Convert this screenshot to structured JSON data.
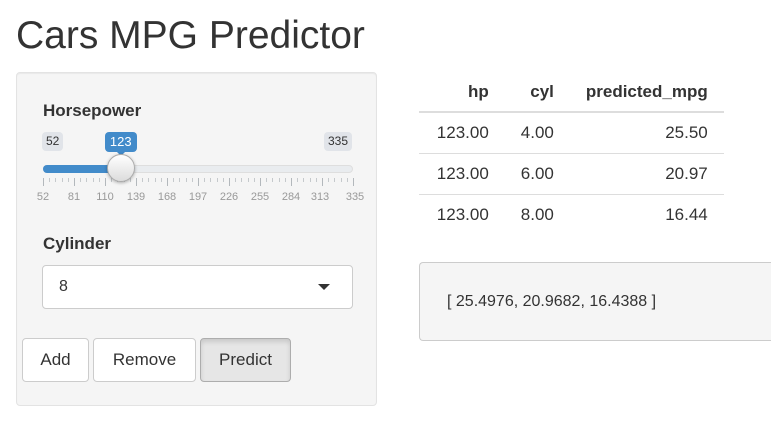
{
  "page": {
    "title": "Cars MPG Predictor"
  },
  "sidebar": {
    "horsepower": {
      "label": "Horsepower",
      "min_label": "52",
      "max_label": "335",
      "value_label": "123",
      "value": 123,
      "min": 52,
      "max": 335,
      "tick_labels": [
        "52",
        "81",
        "110",
        "139",
        "168",
        "197",
        "226",
        "255",
        "284",
        "313",
        "335"
      ]
    },
    "cylinder": {
      "label": "Cylinder",
      "selected": "8"
    },
    "buttons": {
      "add": "Add",
      "remove": "Remove",
      "predict": "Predict"
    }
  },
  "results": {
    "headers": [
      "hp",
      "cyl",
      "predicted_mpg"
    ],
    "rows": [
      [
        "123.00",
        "4.00",
        "25.50"
      ],
      [
        "123.00",
        "6.00",
        "20.97"
      ],
      [
        "123.00",
        "8.00",
        "16.44"
      ]
    ]
  },
  "output_text": "[ 25.4976, 20.9682, 16.4388 ]",
  "colors": {
    "accent": "#428bca",
    "panel": "#f5f5f5"
  }
}
